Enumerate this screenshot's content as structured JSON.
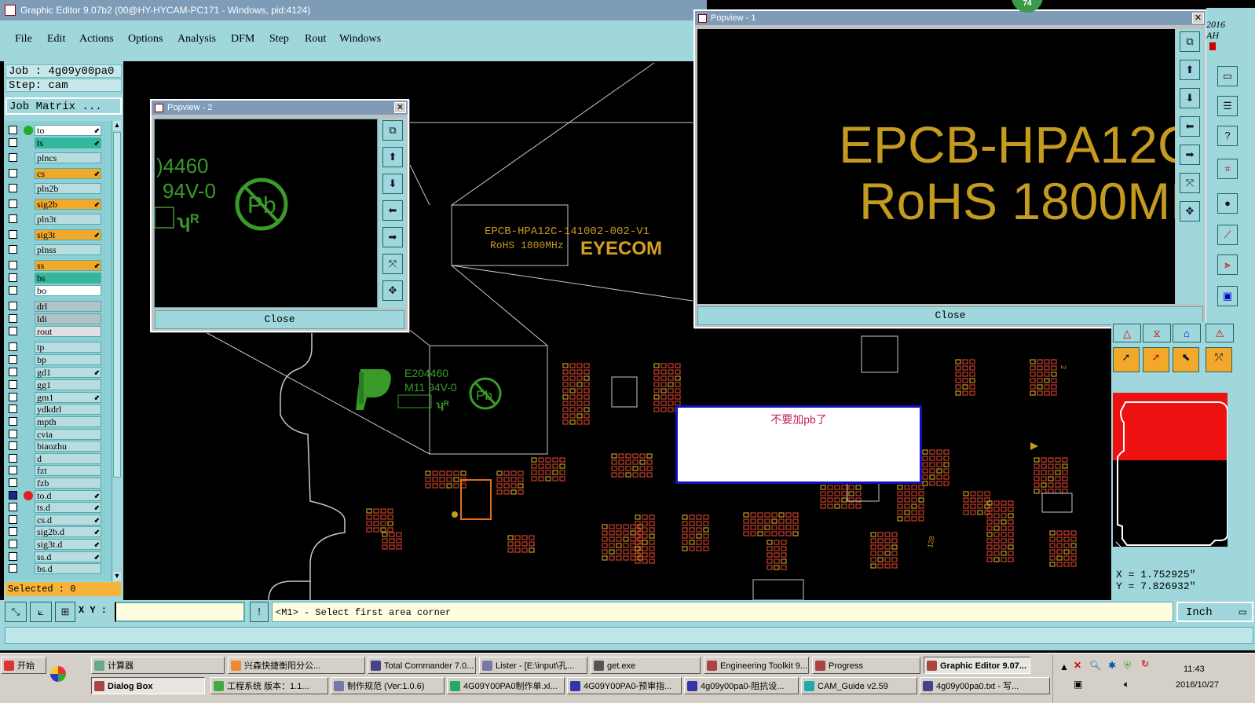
{
  "window": {
    "title": "Graphic Editor 9.07b2 (00@HY-HYCAM-PC171 - Windows, pid:4124)"
  },
  "menu": [
    "File",
    "Edit",
    "Actions",
    "Options",
    "Analysis",
    "DFM",
    "Step",
    "Rout",
    "Windows"
  ],
  "job": {
    "job_label": "Job : 4g09y00pa0",
    "step_label": "Step: cam",
    "matrix_button": "Job Matrix ..."
  },
  "layers": [
    {
      "name": "to",
      "color": "#ffffff",
      "dot": "#22aa22",
      "arrow": true
    },
    {
      "name": "ts",
      "color": "#2fb89a",
      "arrow": true
    },
    {
      "name": "plncs",
      "color": "#b8dde0"
    },
    {
      "name": "cs",
      "color": "#f2a92a",
      "arrow": true
    },
    {
      "name": "pln2b",
      "color": "#b8dde0"
    },
    {
      "name": "sig2b",
      "color": "#f2a92a",
      "arrow": true
    },
    {
      "name": "pln3t",
      "color": "#b8dde0"
    },
    {
      "name": "sig3t",
      "color": "#f2a92a",
      "arrow": true
    },
    {
      "name": "plnss",
      "color": "#b8dde0"
    },
    {
      "name": "ss",
      "color": "#f2a92a",
      "arrow": true
    },
    {
      "name": "bs",
      "color": "#2fb89a"
    },
    {
      "name": "bo",
      "color": "#ffffff"
    },
    {
      "name": "drl",
      "color": "#b0c4c8"
    },
    {
      "name": "ldi",
      "color": "#b0c4c8"
    },
    {
      "name": "rout",
      "color": "#e0e0e0"
    },
    {
      "name": "tp",
      "color": "#b8dde0"
    },
    {
      "name": "bp",
      "color": "#b8dde0"
    },
    {
      "name": "gd1",
      "color": "#b8dde0",
      "arrow": true
    },
    {
      "name": "gg1",
      "color": "#b8dde0"
    },
    {
      "name": "gm1",
      "color": "#b8dde0",
      "arrow": true
    },
    {
      "name": "ydkdrl",
      "color": "#b8dde0"
    },
    {
      "name": "mpth",
      "color": "#b8dde0"
    },
    {
      "name": "cvia",
      "color": "#b8dde0"
    },
    {
      "name": "biaozhu",
      "color": "#b8dde0"
    },
    {
      "name": "d",
      "color": "#b8dde0"
    },
    {
      "name": "fzt",
      "color": "#b8dde0"
    },
    {
      "name": "fzb",
      "color": "#b8dde0"
    },
    {
      "name": "to.d",
      "color": "#b8dde0",
      "dot": "#e02020",
      "arrow": true,
      "sel": true
    },
    {
      "name": "ts.d",
      "color": "#b8dde0",
      "arrow": true
    },
    {
      "name": "cs.d",
      "color": "#b8dde0",
      "arrow": true
    },
    {
      "name": "sig2b.d",
      "color": "#b8dde0",
      "arrow": true
    },
    {
      "name": "sig3t.d",
      "color": "#b8dde0",
      "arrow": true
    },
    {
      "name": "ss.d",
      "color": "#b8dde0",
      "arrow": true
    },
    {
      "name": "bs.d",
      "color": "#b8dde0"
    }
  ],
  "selected_label": "Selected : 0",
  "popview1": {
    "title": "Popview - 1",
    "line1": "EPCB-HPA12C",
    "line2": "RoHS 1800MH",
    "close": "Close"
  },
  "popview2": {
    "title": "Popview - 2",
    "text1": ")4460",
    "text2": "94V-0",
    "pb": "Pb",
    "close": "Close"
  },
  "canvas": {
    "marking1": "EPCB-HPA12C-141002-002-V1",
    "marking2": "RoHS 1800MHz",
    "brand": "EYECOM",
    "ul_code": "E204460",
    "ul_rating": "M11 94V-0",
    "pb": "Pb",
    "note": "不要加pb了",
    "label_128": "128",
    "label_2": "2"
  },
  "coords": {
    "x": "X = 1.752925\"",
    "y": "Y = 7.826932\""
  },
  "statusbar": {
    "xy_label": "X Y :",
    "xy_value": "",
    "prompt": "<M1> - Select first area corner",
    "units": "Inch"
  },
  "badge": "74",
  "edge_text": "2016 AH",
  "taskbar": {
    "start": "开始",
    "row1": [
      {
        "label": "计算器",
        "icon": "#6a8"
      },
      {
        "label": "兴森快捷衡阳分公...",
        "icon": "#e83"
      },
      {
        "label": "Total Commander 7.0...",
        "icon": "#448"
      },
      {
        "label": "Lister - [E:\\input\\孔...",
        "icon": "#77a"
      },
      {
        "label": "get.exe",
        "icon": "#555"
      },
      {
        "label": "Engineering Toolkit 9....",
        "icon": "#a44"
      },
      {
        "label": "Progress",
        "icon": "#a44"
      },
      {
        "label": "Graphic Editor 9.07...",
        "icon": "#a44",
        "active": true
      }
    ],
    "row2": [
      {
        "label": "Dialog Box",
        "icon": "#a44",
        "active": true
      },
      {
        "label": "工程系统  版本：1.1...",
        "icon": "#4a4"
      },
      {
        "label": "制作规范 (Ver:1.0.6)",
        "icon": "#77a"
      },
      {
        "label": "4G09Y00PA0制作单.xl...",
        "icon": "#2a6"
      },
      {
        "label": "4G09Y00PA0-预审指...",
        "icon": "#33a"
      },
      {
        "label": "4g09y00pa0-阻抗设...",
        "icon": "#33a"
      },
      {
        "label": "CAM_Guide v2.59",
        "icon": "#2aa"
      },
      {
        "label": "4g09y00pa0.txt - 写...",
        "icon": "#448"
      }
    ],
    "time": "11:43",
    "date": "2016/10/27"
  },
  "colors": {
    "board_outline": "#c8c8c8",
    "pad": "#c8402a",
    "silk": "#3a9a2a",
    "gold": "#c49a20",
    "panel": "#9fd7dc"
  }
}
